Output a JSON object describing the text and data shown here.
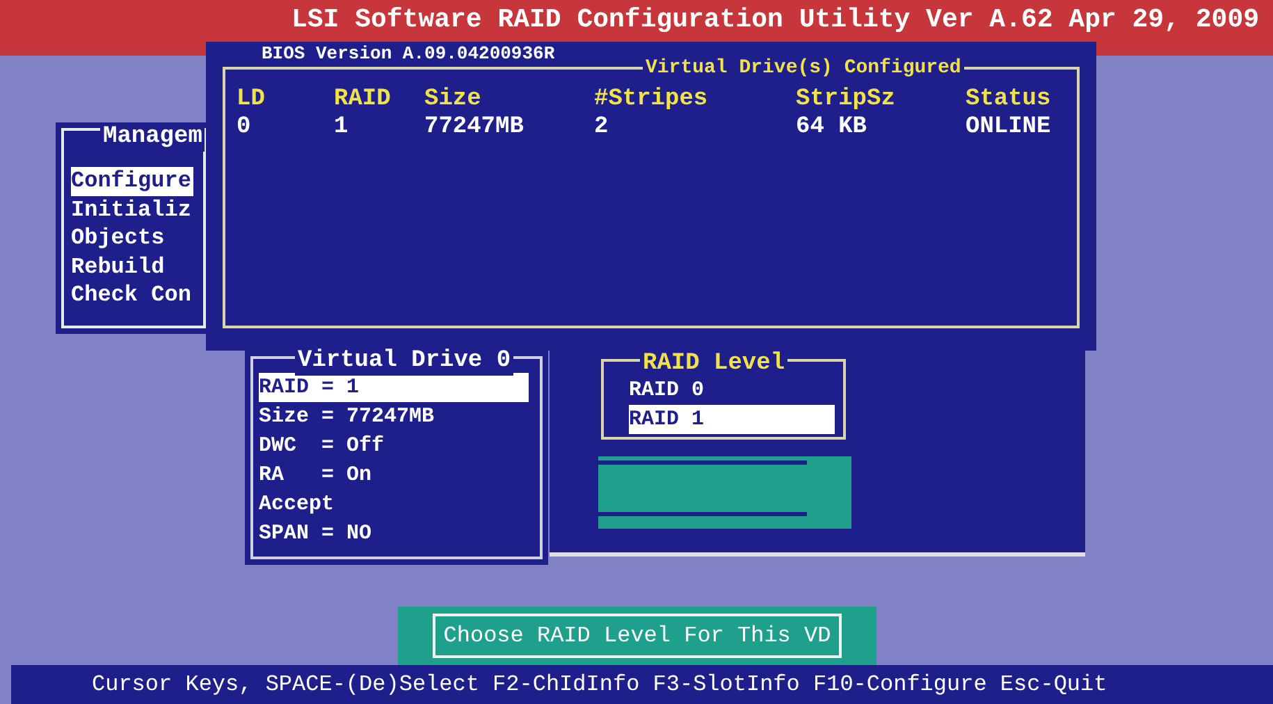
{
  "title": "LSI Software RAID Configuration Utility Ver A.62 Apr 29, 2009",
  "bios_version": "BIOS Version A.09.04200936R",
  "configured_list": {
    "title": "Virtual Drive(s) Configured",
    "columns": [
      "LD",
      "RAID",
      "Size",
      "#Stripes",
      "StripSz",
      "Status"
    ],
    "rows": [
      [
        "0",
        "1",
        "77247MB",
        "2",
        "64 KB",
        "ONLINE"
      ]
    ]
  },
  "management_menu": {
    "title": "Managem",
    "items": [
      {
        "label": "Configure",
        "selected": true
      },
      {
        "label": "Initializ",
        "selected": false
      },
      {
        "label": "Objects",
        "selected": false
      },
      {
        "label": "Rebuild",
        "selected": false
      },
      {
        "label": "Check Con",
        "selected": false
      }
    ]
  },
  "virtual_drive": {
    "title": "Virtual Drive 0",
    "items": [
      {
        "label": "RAID = 1",
        "selected": true
      },
      {
        "label": "Size = 77247MB",
        "selected": false
      },
      {
        "label": "DWC  = Off",
        "selected": false
      },
      {
        "label": "RA   = On",
        "selected": false
      },
      {
        "label": "Accept",
        "selected": false
      },
      {
        "label": "SPAN = NO",
        "selected": false
      }
    ]
  },
  "raid_level": {
    "title": "RAID Level",
    "options": [
      {
        "label": "RAID 0",
        "selected": false
      },
      {
        "label": "RAID 1",
        "selected": true
      }
    ]
  },
  "message": "Choose RAID Level For This VD",
  "status_bar": "Cursor Keys, SPACE-(De)Select F2-ChIdInfo F3-SlotInfo F10-Configure Esc-Quit"
}
